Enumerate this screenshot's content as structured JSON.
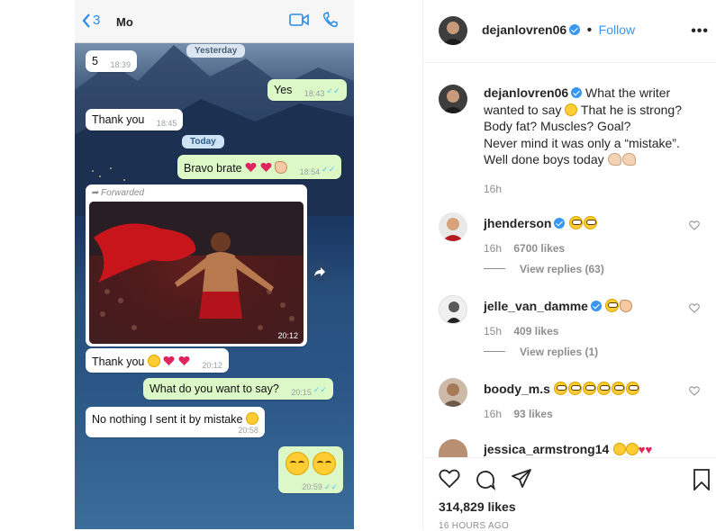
{
  "chat": {
    "back_count": "3",
    "contact": "Mo",
    "messages": {
      "m1_text": "5",
      "m1_time": "18:39",
      "yesterday": "Yesterday",
      "m2_text": "Yes",
      "m2_time": "18:43",
      "m3_text": "Thank you",
      "m3_time": "18:45",
      "today": "Today",
      "m4_text": "Bravo brate",
      "m4_time": "18:54",
      "forwarded": "Forwarded",
      "photo_time": "20:12",
      "m5_text": "Thank you",
      "m5_time": "20:12",
      "m6_text": "What do you want to say?",
      "m6_time": "20:15",
      "m7_text": "No nothing I sent it by mistake",
      "m7_time": "20:58",
      "m8_time": "20:59"
    }
  },
  "post": {
    "username": "dejanlovren06",
    "follow_label": "Follow",
    "dot": "•",
    "more": "•••",
    "caption_user": "dejanlovren06",
    "caption_l1": "What the writer wanted to say",
    "caption_l2": "That he is strong? Body fat? Muscles? Goal?",
    "caption_l3": "Never mind it was only a “mistake”.",
    "caption_l4": "Well done boys today",
    "caption_time": "16h",
    "comments": [
      {
        "user": "jhenderson",
        "time": "16h",
        "likes": "6700 likes",
        "replies": "View replies (63)"
      },
      {
        "user": "jelle_van_damme",
        "time": "15h",
        "likes": "409 likes",
        "replies": "View replies (1)"
      },
      {
        "user": "boody_m.s",
        "time": "16h",
        "likes": "93 likes"
      },
      {
        "user": "jessica_armstrong14"
      }
    ],
    "likes": "314,829 likes",
    "posted": "16 HOURS AGO"
  },
  "colors": {
    "accent": "#3897f0",
    "wa_out": "#dcf8c6",
    "wa_in": "#ffffff"
  }
}
